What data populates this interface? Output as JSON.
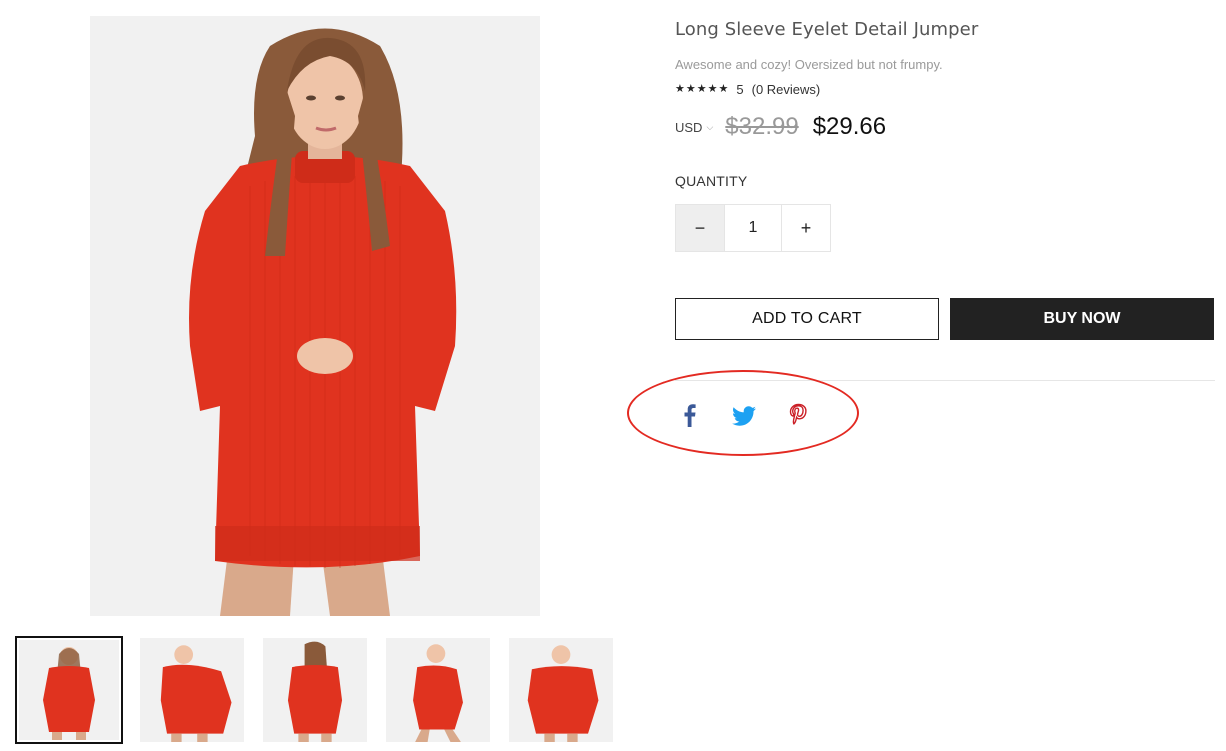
{
  "product": {
    "title": "Long Sleeve Eyelet Detail Jumper",
    "subtitle": "Awesome and cozy! Oversized but not frumpy.",
    "rating_value": "5",
    "reviews_text": "(0 Reviews)",
    "stars": 5
  },
  "price": {
    "currency": "USD",
    "old": "$32.99",
    "new": "$29.66"
  },
  "quantity": {
    "label": "QUANTITY",
    "minus": "−",
    "value": "1",
    "plus": "+"
  },
  "actions": {
    "add_to_cart": "ADD TO CART",
    "buy_now": "BUY NOW"
  },
  "social": {
    "icons": [
      "facebook-icon",
      "twitter-icon",
      "pinterest-icon"
    ],
    "colors": {
      "facebook": "#3b5998",
      "twitter": "#1da1f2",
      "pinterest": "#cb2027"
    }
  },
  "theme": {
    "dress_color": "#e0331f",
    "highlight_color": "#e32a22"
  }
}
